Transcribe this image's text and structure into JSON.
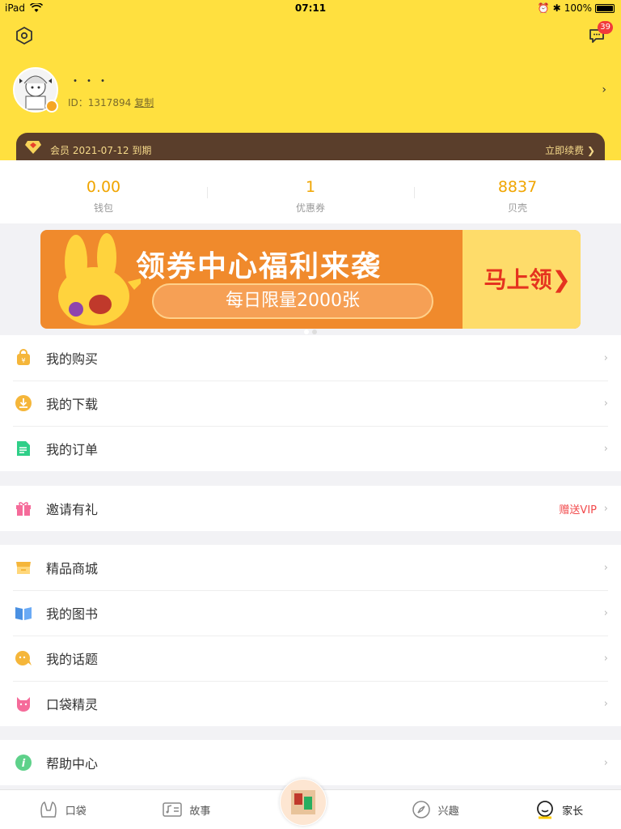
{
  "status": {
    "device": "iPad",
    "time": "07:11",
    "battery": "100%"
  },
  "header": {
    "badge_count": "39",
    "nickname": "・・・",
    "uid": "ID：1317894",
    "copy": "复制"
  },
  "vip": {
    "label": "会员 2021-07-12 到期",
    "renew": "立即续费 ❯"
  },
  "stats": [
    {
      "value": "0.00",
      "label": "钱包"
    },
    {
      "value": "1",
      "label": "优惠券"
    },
    {
      "value": "8837",
      "label": "贝壳"
    }
  ],
  "banner": {
    "title": "领券中心福利来袭",
    "pill": "每日限量2000张",
    "cta": "马上领❯"
  },
  "group1": [
    {
      "label": "我的购买",
      "icon": "bag-icon"
    },
    {
      "label": "我的下载",
      "icon": "download-icon"
    },
    {
      "label": "我的订单",
      "icon": "order-icon"
    }
  ],
  "invite": {
    "label": "邀请有礼",
    "extra": "赠送VIP"
  },
  "group3": [
    {
      "label": "精品商城",
      "icon": "store-icon"
    },
    {
      "label": "我的图书",
      "icon": "book-icon"
    },
    {
      "label": "我的话题",
      "icon": "topic-icon"
    },
    {
      "label": "口袋精灵",
      "icon": "pet-icon"
    }
  ],
  "help": {
    "label": "帮助中心"
  },
  "tabs": [
    {
      "label": "口袋"
    },
    {
      "label": "故事"
    },
    {
      "label": ""
    },
    {
      "label": "兴趣"
    },
    {
      "label": "家长"
    }
  ],
  "colors": {
    "brand": "#ffe03f",
    "accent": "#f0a500",
    "vip_bg": "#5a3e2b",
    "highlight": "#f2494b"
  }
}
